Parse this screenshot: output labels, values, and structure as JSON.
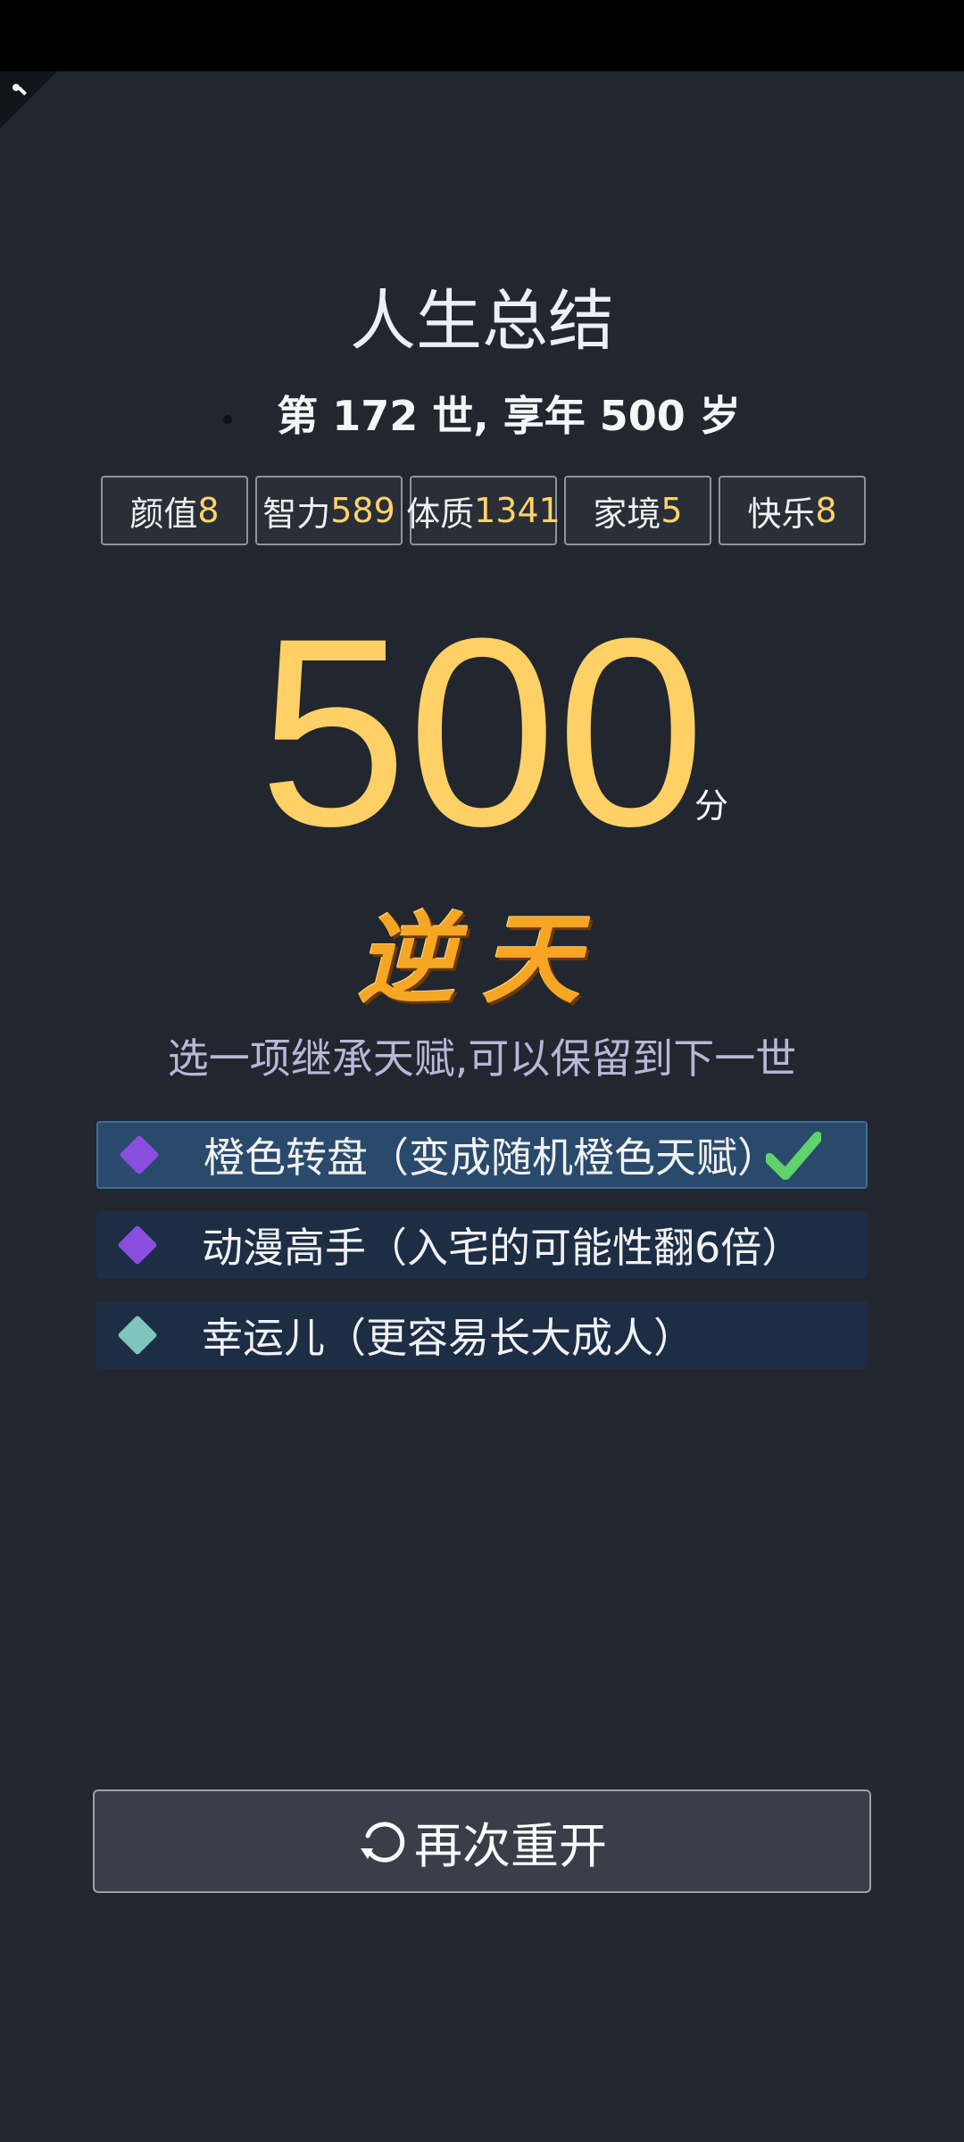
{
  "summary": {
    "title": "人生总结",
    "life_text": "第 172 世, 享年 500 岁"
  },
  "stats": [
    {
      "label": "颜值",
      "value": "8"
    },
    {
      "label": "智力",
      "value": "589"
    },
    {
      "label": "体质",
      "value": "1341"
    },
    {
      "label": "家境",
      "value": "5"
    },
    {
      "label": "快乐",
      "value": "8"
    }
  ],
  "score": {
    "value": "500",
    "unit": "分",
    "grade": "逆天"
  },
  "inherit": {
    "tip": "选一项继承天赋,可以保留到下一世",
    "talents": [
      {
        "label": "橙色转盘（变成随机橙色天赋）",
        "gem_color": "#8a4fe0",
        "selected": true
      },
      {
        "label": "动漫高手（入宅的可能性翻6倍）",
        "gem_color": "#8a4fe0",
        "selected": false
      },
      {
        "label": "幸运儿（更容易长大成人）",
        "gem_color": "#7fc4bd",
        "selected": false
      }
    ]
  },
  "actions": {
    "restart_label": "再次重开",
    "restart_icon": "refresh-icon"
  },
  "colors": {
    "accent": "#ffd066",
    "background": "#22262f",
    "selected": "#2a4a6b",
    "check": "#5fd36a"
  }
}
